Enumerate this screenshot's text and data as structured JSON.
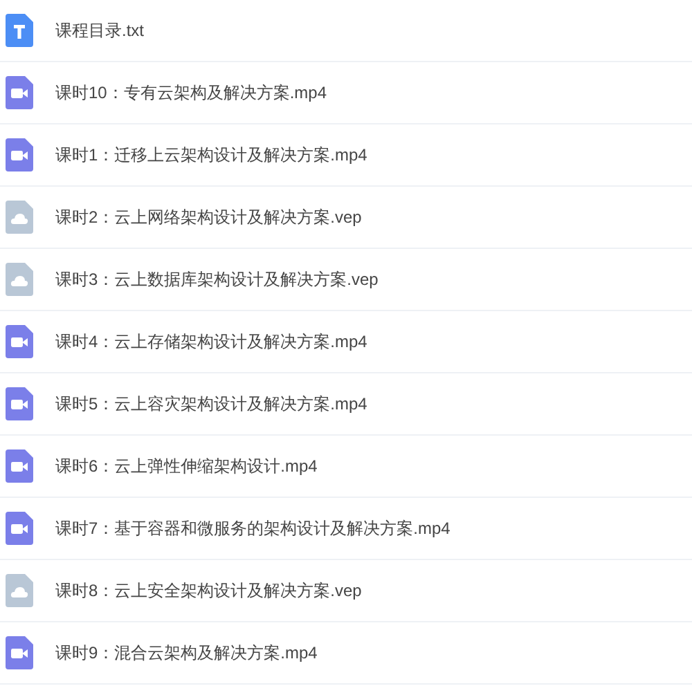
{
  "files": [
    {
      "kind": "text",
      "name": "课程目录.txt"
    },
    {
      "kind": "video",
      "name": "课时10：专有云架构及解决方案.mp4"
    },
    {
      "kind": "video",
      "name": "课时1：迁移上云架构设计及解决方案.mp4"
    },
    {
      "kind": "cloud",
      "name": "课时2：云上网络架构设计及解决方案.vep"
    },
    {
      "kind": "cloud",
      "name": "课时3：云上数据库架构设计及解决方案.vep"
    },
    {
      "kind": "video",
      "name": "课时4：云上存储架构设计及解决方案.mp4"
    },
    {
      "kind": "video",
      "name": "课时5：云上容灾架构设计及解决方案.mp4"
    },
    {
      "kind": "video",
      "name": "课时6：云上弹性伸缩架构设计.mp4"
    },
    {
      "kind": "video",
      "name": "课时7：基于容器和微服务的架构设计及解决方案.mp4"
    },
    {
      "kind": "cloud",
      "name": "课时8：云上安全架构设计及解决方案.vep"
    },
    {
      "kind": "video",
      "name": "课时9：混合云架构及解决方案.mp4"
    }
  ]
}
